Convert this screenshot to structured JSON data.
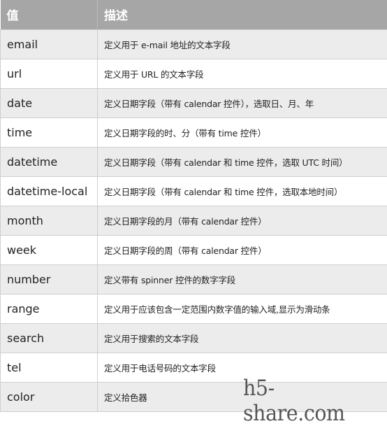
{
  "table": {
    "headers": [
      "值",
      "描述"
    ],
    "rows": [
      {
        "value": "email",
        "description": "定义用于 e-mail 地址的文本字段"
      },
      {
        "value": "url",
        "description": "定义用于 URL 的文本字段"
      },
      {
        "value": "date",
        "description": "定义日期字段（带有 calendar 控件），选取日、月、年"
      },
      {
        "value": "time",
        "description": "定义日期字段的时、分（带有 time 控件）"
      },
      {
        "value": "datetime",
        "description": "定义日期字段（带有 calendar 和 time 控件，选取 UTC 时间）"
      },
      {
        "value": "datetime-local",
        "description": "定义日期字段（带有 calendar 和 time 控件，选取本地时间）"
      },
      {
        "value": "month",
        "description": "定义日期字段的月（带有 calendar 控件）"
      },
      {
        "value": "week",
        "description": "定义日期字段的周（带有 calendar 控件）"
      },
      {
        "value": "number",
        "description": "定义带有 spinner 控件的数字字段"
      },
      {
        "value": "range",
        "description": "定义用于应该包含一定范围内数字值的输入域,显示为滑动条"
      },
      {
        "value": "search",
        "description": "定义用于搜索的文本字段"
      },
      {
        "value": "tel",
        "description": "定义用于电话号码的文本字段"
      },
      {
        "value": "color",
        "description": "定义拾色器"
      }
    ]
  },
  "watermark": "h5-share.com",
  "colors": {
    "header_bg": "#a6a6a6",
    "row_alt_bg": "#ececec",
    "row_bg": "#ffffff"
  }
}
